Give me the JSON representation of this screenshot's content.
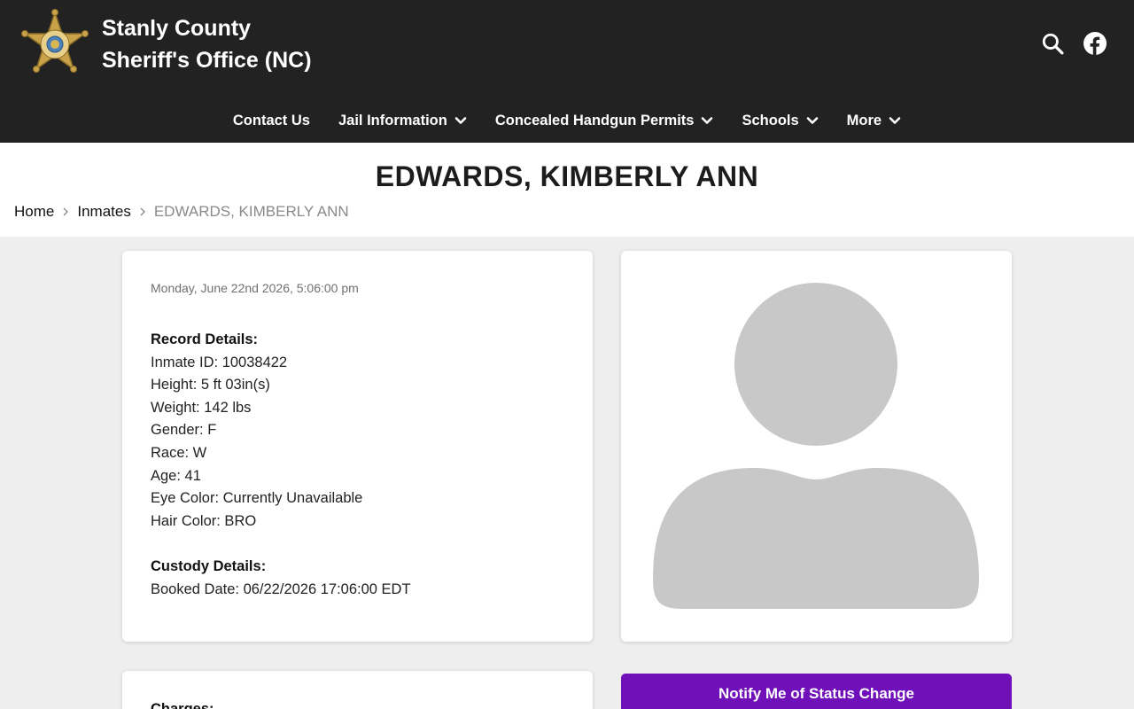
{
  "header": {
    "title_line1": "Stanly County",
    "title_line2": "Sheriff's Office (NC)",
    "logo_text_top": "SHERIFF",
    "logo_text_bottom": "COUNTY",
    "logo_text_center": "STANLY"
  },
  "nav": {
    "items": [
      {
        "label": "Contact Us",
        "has_dropdown": false
      },
      {
        "label": "Jail Information",
        "has_dropdown": true
      },
      {
        "label": "Concealed Handgun Permits",
        "has_dropdown": true
      },
      {
        "label": "Schools",
        "has_dropdown": true
      },
      {
        "label": "More",
        "has_dropdown": true
      }
    ]
  },
  "page": {
    "title": "EDWARDS, KIMBERLY ANN"
  },
  "breadcrumb": {
    "home": "Home",
    "inmates": "Inmates",
    "current": "EDWARDS, KIMBERLY ANN"
  },
  "record": {
    "timestamp": "Monday, June 22nd 2026, 5:06:00 pm",
    "record_heading": "Record Details:",
    "fields": [
      "Inmate ID: 10038422",
      "Height: 5 ft 03in(s)",
      "Weight: 142 lbs",
      "Gender: F",
      "Race: W",
      "Age: 41",
      "Eye Color: Currently Unavailable",
      "Hair Color: BRO"
    ],
    "custody_heading": "Custody Details:",
    "booked_date": "Booked Date: 06/22/2026 17:06:00 EDT"
  },
  "charges": {
    "heading": "Charges:"
  },
  "actions": {
    "notify_label": "Notify Me of Status Change"
  },
  "colors": {
    "header_bg": "#222222",
    "accent_purple": "#6f10b8",
    "page_bg": "#eeeeee",
    "badge_gold": "#c9a24a"
  },
  "icons": {
    "search": "search-icon",
    "facebook": "facebook-icon",
    "dropdown": "chevron-down-icon",
    "breadcrumb_separator": "chevron-right-icon",
    "avatar": "avatar-placeholder-icon"
  }
}
